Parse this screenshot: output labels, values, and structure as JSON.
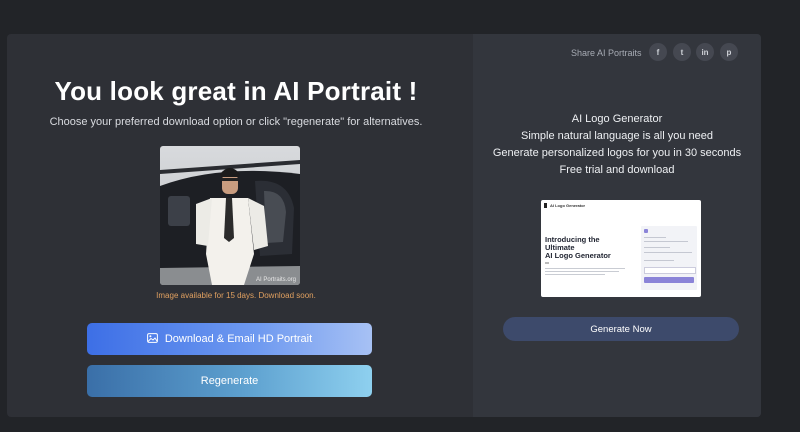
{
  "result": {
    "title": "You look great in AI Portrait !",
    "subtitle": "Choose your preferred download option or click \"regenerate\" for alternatives.",
    "watermark": "AI Portraits.org",
    "availability_notice": "Image available for 15 days. Download soon.",
    "download_button": "Download & Email HD Portrait",
    "regenerate_button": "Regenerate"
  },
  "share": {
    "label": "Share AI Portraits",
    "icons": [
      "facebook-icon",
      "twitter-icon",
      "linkedin-icon",
      "pinterest-icon"
    ],
    "glyphs": [
      "f",
      "t",
      "in",
      "p"
    ]
  },
  "promo": {
    "lines": [
      "AI Logo Generator",
      "Simple natural language is all you need",
      "Generate personalized logos for you in 30 seconds",
      "Free trial and download"
    ],
    "preview": {
      "brand": "AI Logo Generator",
      "headline_1": "Introducing the",
      "headline_2": "Ultimate",
      "headline_3": "AI Logo Generator"
    },
    "cta": "Generate Now"
  },
  "colors": {
    "background": "#222428",
    "card": "#2e3036",
    "download_gradient": [
      "#3d6fe6",
      "#a7c1f4"
    ],
    "regenerate_gradient": [
      "#3a6fa8",
      "#8ed0ef"
    ],
    "notice": "#e0a060",
    "cta": "#3d4a6b"
  }
}
